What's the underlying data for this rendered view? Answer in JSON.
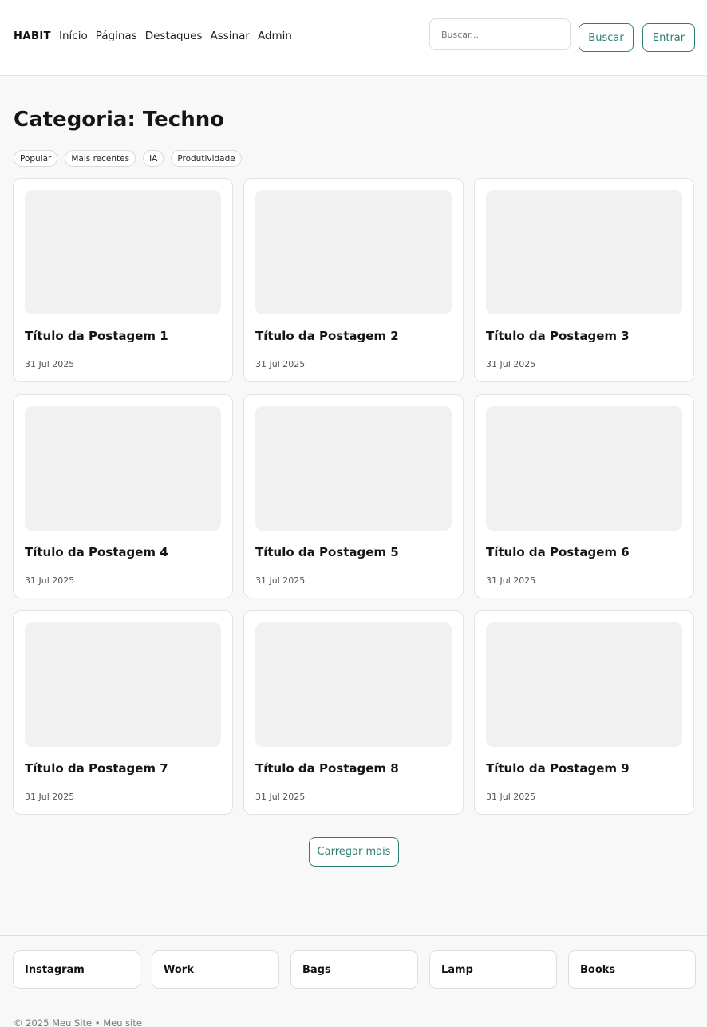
{
  "header": {
    "brand": "HABIT",
    "nav": [
      "Início",
      "Páginas",
      "Destaques",
      "Assinar",
      "Admin"
    ],
    "search_placeholder": "Buscar...",
    "search_button": "Buscar",
    "login_button": "Entrar",
    "accent_color": "#2e7d72"
  },
  "main": {
    "title": "Categoria: Techno",
    "tags": [
      "Popular",
      "Mais recentes",
      "IA",
      "Produtividade"
    ],
    "posts": [
      {
        "title": "Título da Postagem 1",
        "date": "31 Jul 2025"
      },
      {
        "title": "Título da Postagem 2",
        "date": "31 Jul 2025"
      },
      {
        "title": "Título da Postagem 3",
        "date": "31 Jul 2025"
      },
      {
        "title": "Título da Postagem 4",
        "date": "31 Jul 2025"
      },
      {
        "title": "Título da Postagem 5",
        "date": "31 Jul 2025"
      },
      {
        "title": "Título da Postagem 6",
        "date": "31 Jul 2025"
      },
      {
        "title": "Título da Postagem 7",
        "date": "31 Jul 2025"
      },
      {
        "title": "Título da Postagem 8",
        "date": "31 Jul 2025"
      },
      {
        "title": "Título da Postagem 9",
        "date": "31 Jul 2025"
      }
    ],
    "load_more": "Carregar mais"
  },
  "footer": {
    "links": [
      "Instagram",
      "Work",
      "Bags",
      "Lamp",
      "Books"
    ],
    "copyright": "© 2025 Meu Site • Meu site"
  }
}
